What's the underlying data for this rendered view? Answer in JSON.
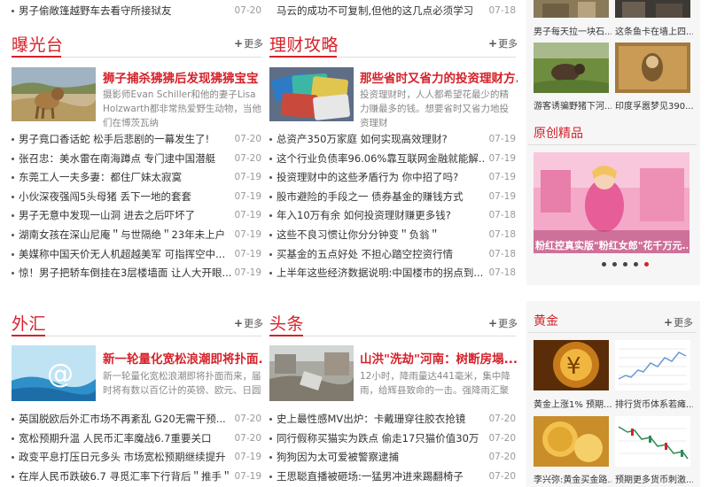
{
  "top_rows": [
    {
      "title": "男子偷敞篷越野车去看守所接狱友",
      "date": "07-20"
    },
    {
      "title": "马云的成功不可复制,但他的这几点必须学习",
      "date": "07-18"
    }
  ],
  "more_label": "更多",
  "sections": {
    "exposure": {
      "title": "曝光台",
      "feature": {
        "headline": "狮子捕杀狒狒后发现狒狒宝宝",
        "desc": "摄影师Evan Schiller和他的妻子Lisa Holzwarth都非常热爱野生动物，当他们在博茨瓦纳"
      },
      "items": [
        {
          "title": "男子竟口香话蛇 松手后悲剧的一幕发生了!",
          "date": "07-20"
        },
        {
          "title": "张召忠：美水雷在南海蹲点 专门逮中国潜艇",
          "date": "07-20"
        },
        {
          "title": "东莞工人一夫多妻：都住厂妹太寂寞",
          "date": "07-19"
        },
        {
          "title": "小伙深夜强闯5头母猪 丢下一地的套套",
          "date": "07-19"
        },
        {
          "title": "男子无意中发现一山洞 进去之后吓坏了",
          "date": "07-19"
        },
        {
          "title": "湖南女孩在深山尼庵＂与世隔绝＂23年未上户",
          "date": "07-19"
        },
        {
          "title": "美媒称中国天价无人机超越美军 可指挥空中...",
          "date": "07-19"
        },
        {
          "title": "惊！男子把轿车倒挂在3层楼墙面 让人大开眼...",
          "date": "07-19"
        }
      ]
    },
    "finance": {
      "title": "理财攻略",
      "feature": {
        "headline": "那些省时又省力的投资理财方...",
        "desc": "投资理财时，人人都希望花最少的精力赚最多的钱。想要省时又省力地投资理财"
      },
      "items": [
        {
          "title": "总资产350万家庭 如何实现高效理财?",
          "date": "07-19"
        },
        {
          "title": "这个行业负债率96.06%靠互联网金融就能解...",
          "date": "07-19"
        },
        {
          "title": "投资理财中的这些矛盾行为 你中招了吗?",
          "date": "07-19"
        },
        {
          "title": "股市避险的手段之一 债券基金的赚钱方式",
          "date": "07-19"
        },
        {
          "title": "年入10万有余 如何投资理财赚更多钱?",
          "date": "07-18"
        },
        {
          "title": "这些不良习惯让你分分钟变＂负翁＂",
          "date": "07-18"
        },
        {
          "title": "买基金的五点好处 不担心踏空控资行情",
          "date": "07-18"
        },
        {
          "title": "上半年这些经济数据说明:中国楼市的拐点到...",
          "date": "07-18"
        }
      ]
    },
    "forex": {
      "title": "外汇",
      "feature": {
        "headline": "新一轮量化宽松浪潮即将扑面...",
        "desc": "新一轮量化宽松浪潮即将扑面而来，届时将有数以百亿计的英镑、欧元、日圆甚..."
      },
      "items": [
        {
          "title": "英国脱欧后外汇市场不再紊乱 G20无需干预...",
          "date": "07-20"
        },
        {
          "title": "宽松预期升温 人民币汇率魔战6.7重要关口",
          "date": "07-20"
        },
        {
          "title": "政变平息打压日元多头 市场宽松预期继续提升",
          "date": "07-19"
        },
        {
          "title": "在岸人民币跌破6.7 寻觅汇率下行背后＂推手＂",
          "date": "07-19"
        }
      ]
    },
    "headlines": {
      "title": "头条",
      "feature": {
        "headline": "山洪\"洗劫\"河南：树断房塌...",
        "desc": "12小时，降雨量达441毫米，集中降雨，给辉县致命的一击。强降雨汇聚成的山洪，"
      },
      "items": [
        {
          "title": "史上最性感MV出炉：卡戴珊穿往胶衣抢镜",
          "date": "07-20"
        },
        {
          "title": "同行假称买猫实为跌点 偷走17只猫价值30万",
          "date": "07-20"
        },
        {
          "title": "狗狗因为太可爱被警察逮捕",
          "date": "07-20"
        },
        {
          "title": "王思聪直播被砸场:一猛男冲进来踢翻椅子",
          "date": "07-20"
        }
      ]
    }
  },
  "sidebar": {
    "top_captions": [
      "男子每天拉一块石...",
      "这条鱼卡在墙上四...",
      "游客诱骗野猪下河...",
      "印度孚嚣梦见390..."
    ],
    "original": {
      "title": "原创精品",
      "slide_caption": "粉红控真实版\"粉红女郎\"花千万元...",
      "slide_count": 5,
      "active_slide": 4
    },
    "gold": {
      "title": "黄金",
      "captions": [
        "黄金上涨1% 预期...",
        "排行货币体系若瘫...",
        "李兴弥:黄金买金路...",
        "预期更多货币刺激..."
      ]
    }
  },
  "colors": {
    "accent": "#d5222a",
    "date": "#999999",
    "divider": "#dddddd"
  }
}
